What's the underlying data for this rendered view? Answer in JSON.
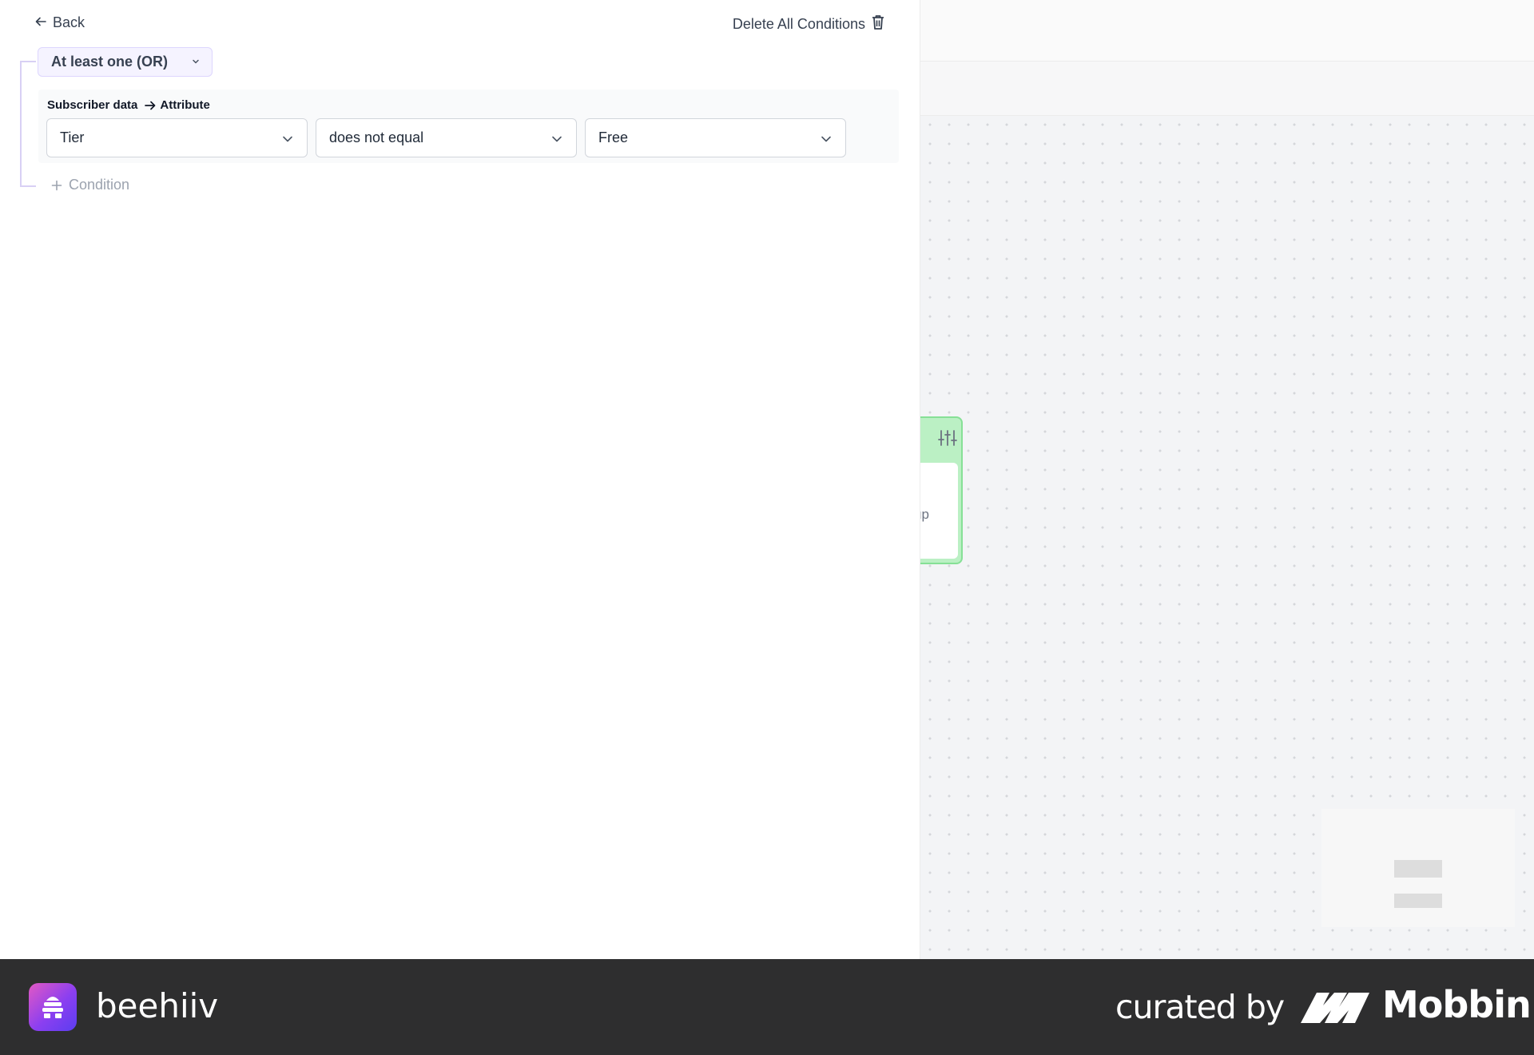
{
  "panel": {
    "back_label": "Back",
    "delete_all_label": "Delete All Conditions",
    "logic_operator": "At least one (OR)",
    "condition": {
      "source": "Subscriber data",
      "type": "Attribute",
      "field": "Tier",
      "operator": "does not equal",
      "value": "Free"
    },
    "add_condition_label": "Condition"
  },
  "canvas": {
    "node_partial_label": "up"
  },
  "footer": {
    "brand": "beehiiv",
    "curated_by": "curated by",
    "curator": "Mobbin"
  },
  "colors": {
    "accent_purple": "#ddd6fe",
    "node_green": "#bbf0c4",
    "footer_bg": "#2e2e2f"
  }
}
